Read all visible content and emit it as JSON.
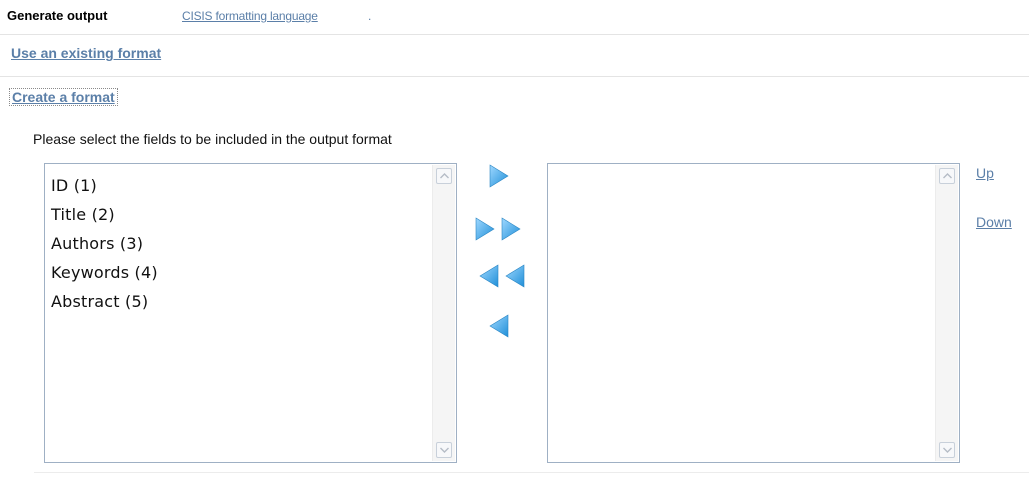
{
  "header": {
    "title": "Generate output",
    "link": "CISIS formatting language",
    "link_suffix": "."
  },
  "sections": {
    "use_existing": "Use an existing format",
    "create": "Create a format"
  },
  "instruction": "Please select the fields to be included in the output format",
  "source_fields": [
    "ID (1)",
    "Title (2)",
    "Authors (3)",
    "Keywords (4)",
    "Abstract (5)"
  ],
  "selected_fields": [],
  "order_controls": {
    "up": "Up",
    "down": "Down"
  },
  "colors": {
    "link": "#5b7fa8",
    "arrow": "#3aa7e8",
    "list_border": "#9fb0c4"
  },
  "icons": {
    "move_right": "arrow-right-icon",
    "move_all_right": "double-arrow-right-icon",
    "move_all_left": "double-arrow-left-icon",
    "move_left": "arrow-left-icon"
  }
}
